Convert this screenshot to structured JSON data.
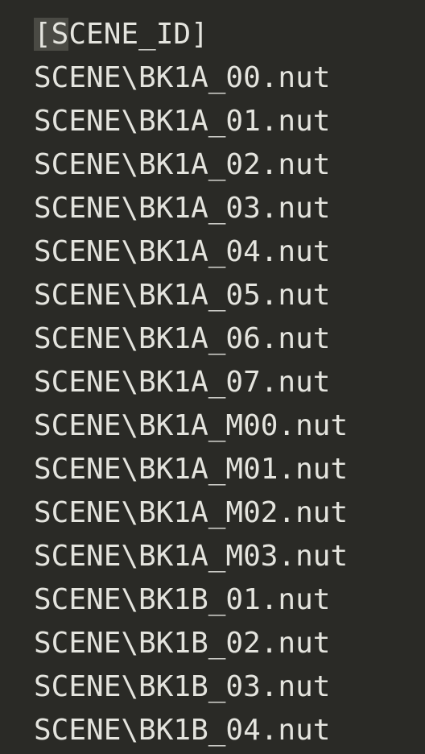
{
  "editor": {
    "top_partial_glyph": "'",
    "lines": [
      "[SCENE_ID]",
      "SCENE\\BK1A_00.nut",
      "SCENE\\BK1A_01.nut",
      "SCENE\\BK1A_02.nut",
      "SCENE\\BK1A_03.nut",
      "SCENE\\BK1A_04.nut",
      "SCENE\\BK1A_05.nut",
      "SCENE\\BK1A_06.nut",
      "SCENE\\BK1A_07.nut",
      "SCENE\\BK1A_M00.nut",
      "SCENE\\BK1A_M01.nut",
      "SCENE\\BK1A_M02.nut",
      "SCENE\\BK1A_M03.nut",
      "SCENE\\BK1B_01.nut",
      "SCENE\\BK1B_02.nut",
      "SCENE\\BK1B_03.nut",
      "SCENE\\BK1B_04.nut"
    ],
    "colors": {
      "background": "#2a2a26",
      "text": "#e4e4de",
      "selection": "#4a4a44"
    }
  }
}
